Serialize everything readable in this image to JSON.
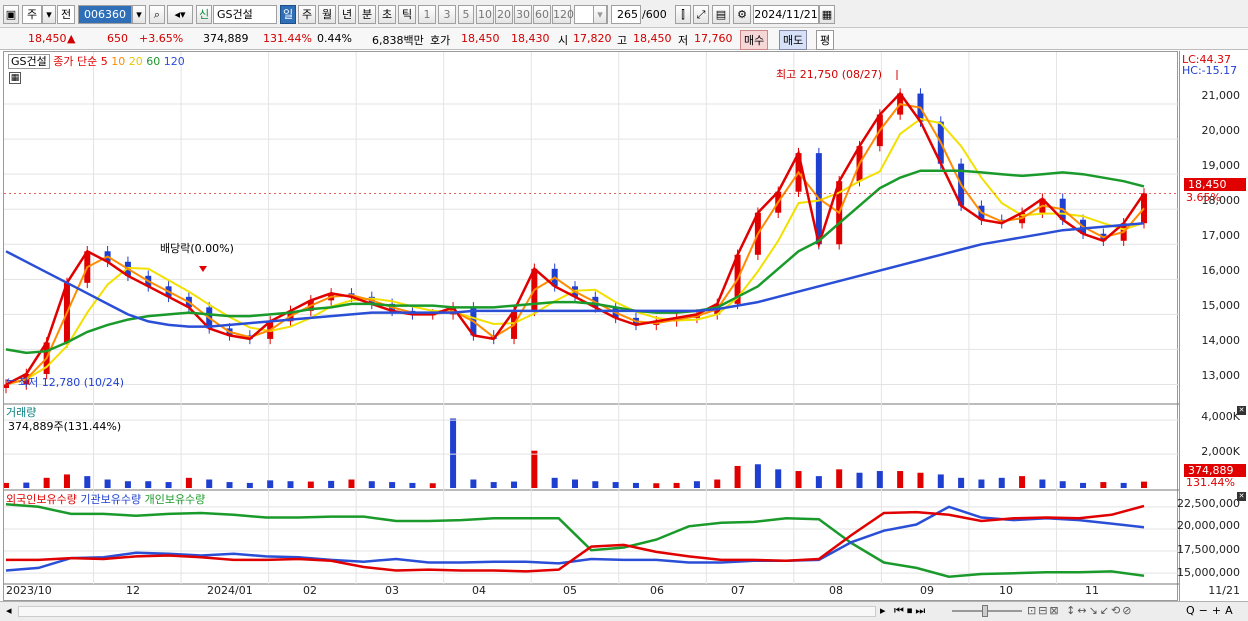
{
  "toolbar": {
    "market": "주",
    "prev": "전",
    "code": "006360",
    "name": "GS건설",
    "sin": "신",
    "periods": [
      "일",
      "주",
      "월",
      "년",
      "분",
      "초",
      "틱"
    ],
    "numbers": [
      "1",
      "3",
      "5",
      "10",
      "20",
      "30",
      "60",
      "120"
    ],
    "count": "265",
    "total": "/600",
    "date": "2024/11/21"
  },
  "quote": {
    "price": "18,450",
    "change": "650",
    "pct": "+3.65%",
    "volume": "374,889",
    "vol_ratio": "131.44%",
    "turnover": "0.44%",
    "amount": "6,838백만",
    "hoga_label": "호가",
    "ask": "18,450",
    "bid": "18,430",
    "open_label": "시",
    "open": "17,820",
    "high_label": "고",
    "high": "18,450",
    "low_label": "저",
    "low": "17,760",
    "buy": "매수",
    "sell": "매도",
    "avg": "평"
  },
  "legend": {
    "name": "GS건설",
    "ma_label": "종가 단순",
    "ma": [
      "5",
      "10",
      "20",
      "60",
      "120"
    ],
    "volume_title": "거래량",
    "volume_value": "374,889주(131.44%)",
    "foreign": "외국인보유수량",
    "inst": "기관보유수량",
    "personal": "개인보유수량"
  },
  "annotations": {
    "high": "최고 21,750 (08/27)",
    "low": "최저 12,780 (10/24)",
    "dividend": "배당락(0.00%)",
    "lc": "LC:44.37",
    "hc": "HC:-15.17"
  },
  "scale": {
    "price_ticks": [
      "21,000",
      "20,000",
      "19,000",
      "18,000",
      "17,000",
      "16,000",
      "15,000",
      "14,000",
      "13,000"
    ],
    "current_price": "18,450",
    "current_pct": "3.65%",
    "volume_ticks": [
      "4,000K",
      "2,000K"
    ],
    "current_volume": "374,889",
    "current_vol_pct": "131.44%",
    "holding_ticks": [
      "22,500,000",
      "20,000,000",
      "17,500,000",
      "15,000,000"
    ]
  },
  "xaxis": [
    "2023/10",
    "12",
    "2024/01",
    "02",
    "03",
    "04",
    "05",
    "06",
    "07",
    "08",
    "09",
    "10",
    "11",
    "11/21"
  ],
  "colors": {
    "ma5": "#e00000",
    "ma10": "#ff8c00",
    "ma20": "#f2e000",
    "ma60": "#1a9a2a",
    "ma120": "#2a4fd6",
    "up": "#e00000",
    "down": "#1f3fd0"
  },
  "chart_data": {
    "type": "line",
    "title": "GS건설",
    "price_range": [
      12500,
      22200
    ],
    "months": [
      "2023/10",
      "12",
      "2024/01",
      "02",
      "03",
      "04",
      "05",
      "06",
      "07",
      "08",
      "09",
      "10",
      "11"
    ],
    "close": [
      13000,
      13300,
      14200,
      15900,
      16800,
      16500,
      16100,
      15800,
      15500,
      15200,
      14600,
      14400,
      14300,
      14800,
      15100,
      15400,
      15600,
      15500,
      15300,
      15100,
      15000,
      15000,
      15200,
      14400,
      14300,
      15100,
      16300,
      15800,
      15500,
      15200,
      14900,
      14700,
      14800,
      14900,
      15000,
      15300,
      16700,
      17900,
      18500,
      19600,
      17000,
      18800,
      19800,
      20700,
      21300,
      20500,
      19300,
      18100,
      17700,
      17600,
      17900,
      18300,
      17700,
      17300,
      17100,
      17600,
      18450
    ],
    "ma60": [
      14000,
      13900,
      13950,
      14200,
      14500,
      14700,
      14850,
      14950,
      15000,
      15050,
      15000,
      14950,
      14950,
      15000,
      15050,
      15150,
      15200,
      15300,
      15300,
      15250,
      15250,
      15250,
      15200,
      15200,
      15200,
      15250,
      15300,
      15350,
      15350,
      15300,
      15200,
      15100,
      15050,
      15050,
      15100,
      15200,
      15500,
      15800,
      16300,
      16800,
      17100,
      17600,
      18100,
      18600,
      18900,
      19100,
      19100,
      19100,
      19050,
      19000,
      18950,
      19000,
      19050,
      19000,
      18900,
      18800,
      18650
    ],
    "ma120": [
      16800,
      16500,
      16200,
      15900,
      15600,
      15300,
      15000,
      14800,
      14700,
      14650,
      14650,
      14700,
      14750,
      14800,
      14850,
      14900,
      14950,
      15000,
      15050,
      15050,
      15050,
      15050,
      15050,
      15100,
      15100,
      15100,
      15100,
      15100,
      15100,
      15100,
      15100,
      15100,
      15100,
      15100,
      15100,
      15150,
      15250,
      15350,
      15500,
      15650,
      15800,
      15950,
      16100,
      16250,
      16400,
      16550,
      16700,
      16850,
      17000,
      17100,
      17200,
      17300,
      17400,
      17450,
      17500,
      17550,
      17600
    ],
    "volume_range_k": [
      0,
      4600
    ],
    "volume_k": [
      300,
      320,
      600,
      800,
      700,
      500,
      400,
      400,
      350,
      600,
      500,
      350,
      300,
      450,
      400,
      380,
      420,
      500,
      400,
      350,
      300,
      280,
      4100,
      500,
      350,
      380,
      2200,
      600,
      500,
      400,
      350,
      300,
      280,
      300,
      400,
      500,
      1300,
      1400,
      1100,
      1000,
      700,
      1100,
      900,
      1000,
      1000,
      900,
      800,
      600,
      500,
      600,
      700,
      500,
      400,
      300,
      350,
      300,
      375
    ],
    "foreign_holding": [
      16500000,
      16500000,
      16700000,
      16600000,
      16900000,
      17000000,
      16800000,
      16500000,
      16500000,
      16600000,
      16400000,
      15700000,
      15300000,
      15400000,
      15300000,
      15300000,
      15200000,
      15400000,
      18000000,
      18200000,
      17400000,
      16900000,
      16500000,
      16500000,
      16400000,
      16600000,
      19300000,
      21800000,
      21900000,
      21600000,
      20900000,
      21200000,
      21300000,
      21200000,
      21600000,
      22600000
    ],
    "institution_holding": [
      15300000,
      15600000,
      16700000,
      16800000,
      17300000,
      17200000,
      17000000,
      17200000,
      16900000,
      16800000,
      16500000,
      16300000,
      16600000,
      16200000,
      16200000,
      16300000,
      16300000,
      16100000,
      16600000,
      16500000,
      16500000,
      16200000,
      16200000,
      16400000,
      16400000,
      16500000,
      18500000,
      19800000,
      20500000,
      22500000,
      21300000,
      21000000,
      21200000,
      21000000,
      20600000,
      20200000
    ],
    "personal_holding": [
      22800000,
      22500000,
      21700000,
      21700000,
      21500000,
      21700000,
      21800000,
      21600000,
      21300000,
      21300000,
      21400000,
      21400000,
      20900000,
      20900000,
      21000000,
      21200000,
      21200000,
      21200000,
      17600000,
      17900000,
      18800000,
      20300000,
      20700000,
      20800000,
      21200000,
      21100000,
      18400000,
      16200000,
      15600000,
      14600000,
      14900000,
      15000000,
      15100000,
      15100000,
      15200000,
      14700000
    ],
    "holding_range": [
      14000000,
      23500000
    ]
  }
}
